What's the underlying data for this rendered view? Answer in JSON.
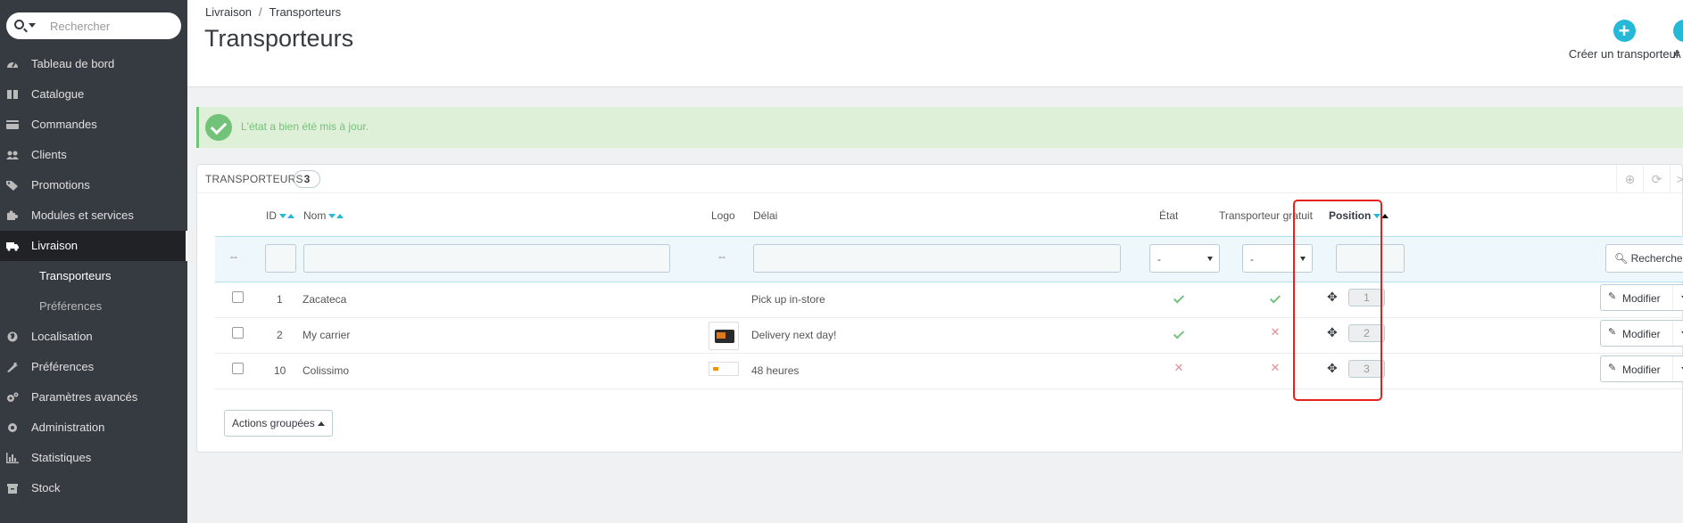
{
  "sidebar": {
    "search_placeholder": "Rechercher",
    "items": [
      {
        "label": "Tableau de bord",
        "icon": "dashboard-icon"
      },
      {
        "label": "Catalogue",
        "icon": "book-icon"
      },
      {
        "label": "Commandes",
        "icon": "credit-card-icon"
      },
      {
        "label": "Clients",
        "icon": "users-icon"
      },
      {
        "label": "Promotions",
        "icon": "tags-icon"
      },
      {
        "label": "Modules et services",
        "icon": "puzzle-icon"
      },
      {
        "label": "Livraison",
        "icon": "truck-icon"
      },
      {
        "label": "Localisation",
        "icon": "globe-icon"
      },
      {
        "label": "Préférences",
        "icon": "wrench-icon"
      },
      {
        "label": "Paramètres avancés",
        "icon": "cogs-icon"
      },
      {
        "label": "Administration",
        "icon": "cog-icon"
      },
      {
        "label": "Statistiques",
        "icon": "bar-chart-icon"
      },
      {
        "label": "Stock",
        "icon": "archive-icon"
      }
    ],
    "subitems": [
      {
        "label": "Transporteurs"
      },
      {
        "label": "Préférences"
      }
    ]
  },
  "header": {
    "breadcrumb": [
      "Livraison",
      "Transporteurs"
    ],
    "title": "Transporteurs",
    "create_label": "Créer un transporteur",
    "extra_label": "A"
  },
  "alert": {
    "message": "L'état a bien été mis à jour."
  },
  "panel": {
    "title": "TRANSPORTEURS",
    "count": "3",
    "columns": {
      "id": "ID",
      "name": "Nom",
      "logo": "Logo",
      "delay": "Délai",
      "status": "État",
      "free": "Transporteur gratuit",
      "position": "Position"
    },
    "filters": {
      "dash": "--",
      "status_select": "-",
      "free_select": "-",
      "search_label": "Rechercher"
    },
    "rows": [
      {
        "id": "1",
        "name": "Zacateca",
        "delay": "Pick up in-store",
        "status": true,
        "free": true,
        "position": "1",
        "action": "Modifier",
        "logo": "none"
      },
      {
        "id": "2",
        "name": "My carrier",
        "delay": "Delivery next day!",
        "status": true,
        "free": false,
        "position": "2",
        "action": "Modifier",
        "logo": "truck"
      },
      {
        "id": "10",
        "name": "Colissimo",
        "delay": "48 heures",
        "status": false,
        "free": false,
        "position": "3",
        "action": "Modifier",
        "logo": "colissimo"
      }
    ],
    "bulk_label": "Actions groupées"
  },
  "colors": {
    "accent": "#25b9d7",
    "success": "#72c279",
    "danger": "#e08f95",
    "highlight": "#e5201f"
  }
}
